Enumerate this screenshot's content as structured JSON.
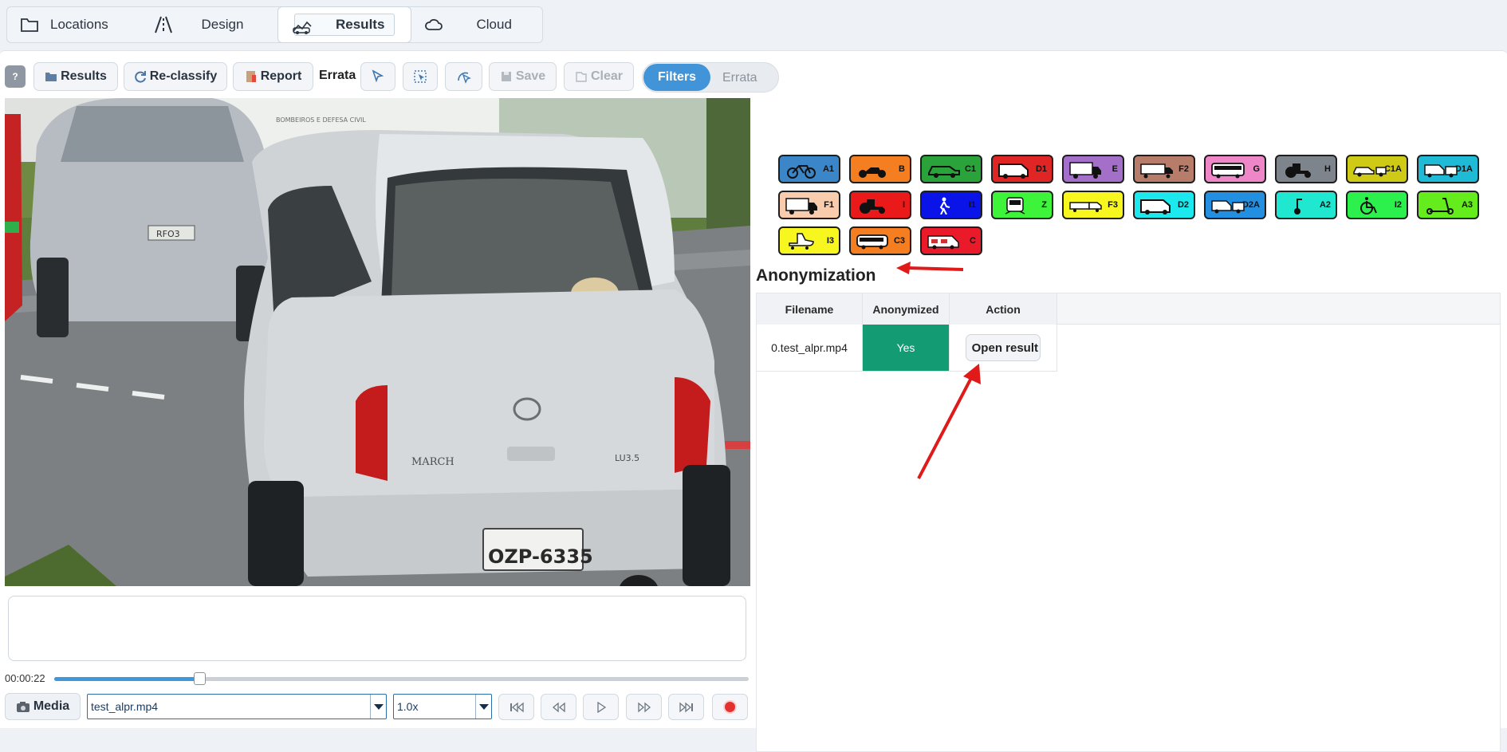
{
  "top_nav": {
    "tabs": [
      {
        "label": "Locations",
        "icon": "folder-icon"
      },
      {
        "label": "Design",
        "icon": "road-icon"
      },
      {
        "label": "Results",
        "icon": "results-icon",
        "active": true
      },
      {
        "label": "Cloud",
        "icon": "cloud-icon"
      }
    ]
  },
  "toolbar": {
    "help_label": "?",
    "results_label": "Results",
    "reclassify_label": "Re-classify",
    "report_label": "Report",
    "errata_label": "Errata",
    "save_label": "Save",
    "clear_label": "Clear",
    "segmented": {
      "active": "Filters",
      "inactive": "Errata"
    }
  },
  "player": {
    "time": "00:00:22",
    "progress": 0.209,
    "media_label": "Media",
    "file": "test_alpr.mp4",
    "speed": "1.0x",
    "scene": {
      "plate_left": "OZP-6335",
      "plate_back": "RFO3",
      "car_model": "MARCH",
      "trim": "LU3.5",
      "wall_text": "BOMBEIROS E DEFESA CIVIL"
    }
  },
  "vehicle_classes": [
    {
      "code": "A1",
      "color": "#3b86c8",
      "icon": "bicycle-icon"
    },
    {
      "code": "B",
      "color": "#f47e20",
      "icon": "motorcycle-icon"
    },
    {
      "code": "C1",
      "color": "#2ba33b",
      "icon": "car-icon"
    },
    {
      "code": "D1",
      "color": "#e02525",
      "icon": "van-icon"
    },
    {
      "code": "E",
      "color": "#a36fc8",
      "icon": "truck-icon"
    },
    {
      "code": "F2",
      "color": "#b87c6a",
      "icon": "semi-truck-icon"
    },
    {
      "code": "G",
      "color": "#ee86c8",
      "icon": "bus-icon"
    },
    {
      "code": "H",
      "color": "#7e848b",
      "icon": "tractor-icon"
    },
    {
      "code": "C1A",
      "color": "#cfca16",
      "icon": "car-trailer-icon"
    },
    {
      "code": "D1A",
      "color": "#1fbbd6",
      "icon": "van-trailer-icon"
    },
    {
      "code": "F1",
      "color": "#f8ccad",
      "icon": "truck-icon"
    },
    {
      "code": "I",
      "color": "#ea1a1a",
      "icon": "tractor-icon"
    },
    {
      "code": "I1",
      "color": "#0a14e8",
      "icon": "pedestrian-icon"
    },
    {
      "code": "Z",
      "color": "#3df43a",
      "icon": "train-icon"
    },
    {
      "code": "F3",
      "color": "#f7f71f",
      "icon": "long-truck-icon"
    },
    {
      "code": "D2",
      "color": "#1ce9ee",
      "icon": "van-icon"
    },
    {
      "code": "D2A",
      "color": "#238fe0",
      "icon": "van-trailer-icon"
    },
    {
      "code": "A2",
      "color": "#20e7cf",
      "icon": "segway-icon"
    },
    {
      "code": "I2",
      "color": "#2cf14c",
      "icon": "wheelchair-icon"
    },
    {
      "code": "A3",
      "color": "#64ec1c",
      "icon": "scooter-icon"
    },
    {
      "code": "I3",
      "color": "#f7f71f",
      "icon": "skate-icon"
    },
    {
      "code": "C3",
      "color": "#f47e20",
      "icon": "minibus-icon"
    },
    {
      "code": "C",
      "color": "#ea1a2a",
      "icon": "motorhome-icon"
    }
  ],
  "anonymization": {
    "title": "Anonymization",
    "columns": [
      "Filename",
      "Anonymized",
      "Action"
    ],
    "rows": [
      {
        "filename": "0.test_alpr.mp4",
        "anonymized": "Yes",
        "action": "Open result"
      }
    ],
    "anonymized_color": "#139b74"
  }
}
